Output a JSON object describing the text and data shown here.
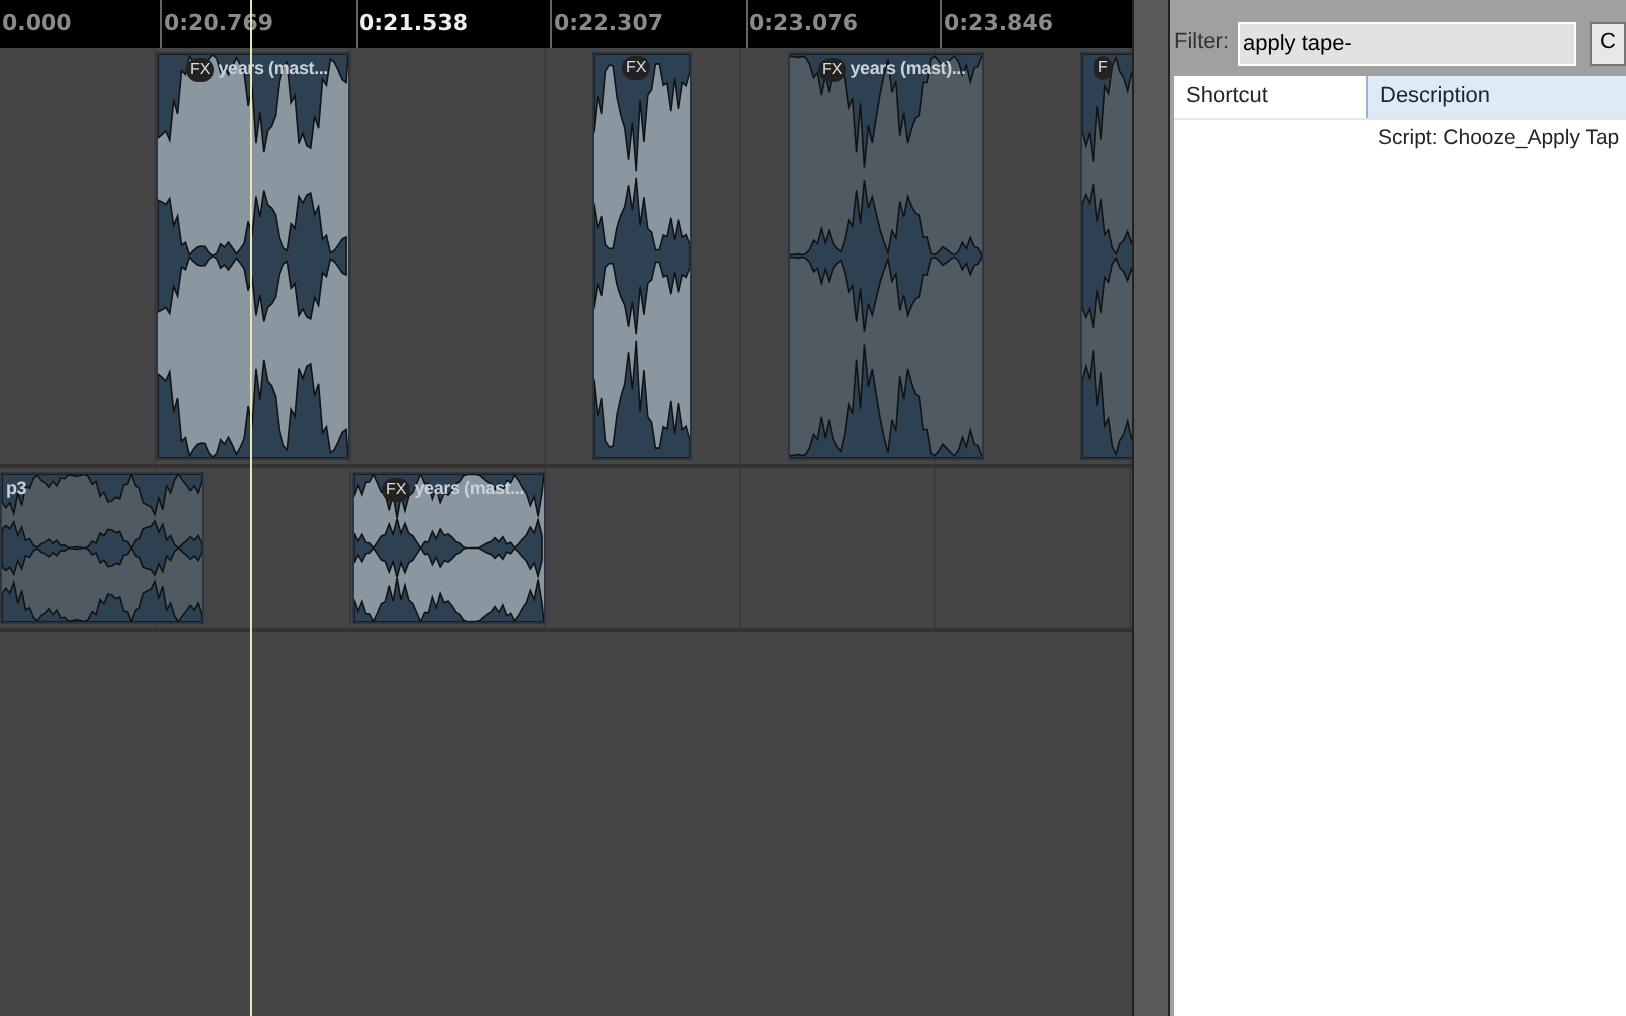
{
  "ruler": {
    "ticks": [
      {
        "label": "0.000",
        "current": false
      },
      {
        "label": "0:20.769",
        "current": false
      },
      {
        "label": "0:21.538",
        "current": true
      },
      {
        "label": "0:22.307",
        "current": false
      },
      {
        "label": "0:23.076",
        "current": false
      },
      {
        "label": "0:23.846",
        "current": false
      }
    ]
  },
  "tracks": [
    {
      "items": [
        {
          "label": "years (mast...",
          "fx": "FX",
          "selected": false
        },
        {
          "fx": "FX",
          "selected": false
        },
        {
          "label": "years (mast)...",
          "fx": "FX",
          "selected": true
        },
        {
          "fx": "F",
          "selected": true
        }
      ]
    },
    {
      "items": [
        {
          "label": "p3",
          "selected": true
        },
        {
          "label": "years (mast...",
          "fx": "FX",
          "selected": false
        }
      ]
    }
  ],
  "actions": {
    "filter_label": "Filter:",
    "filter_value": "apply tape-",
    "button": "C",
    "columns": [
      "Shortcut",
      "Description"
    ],
    "rows": [
      [
        "",
        "Script: Chooze_Apply Tap"
      ]
    ]
  }
}
